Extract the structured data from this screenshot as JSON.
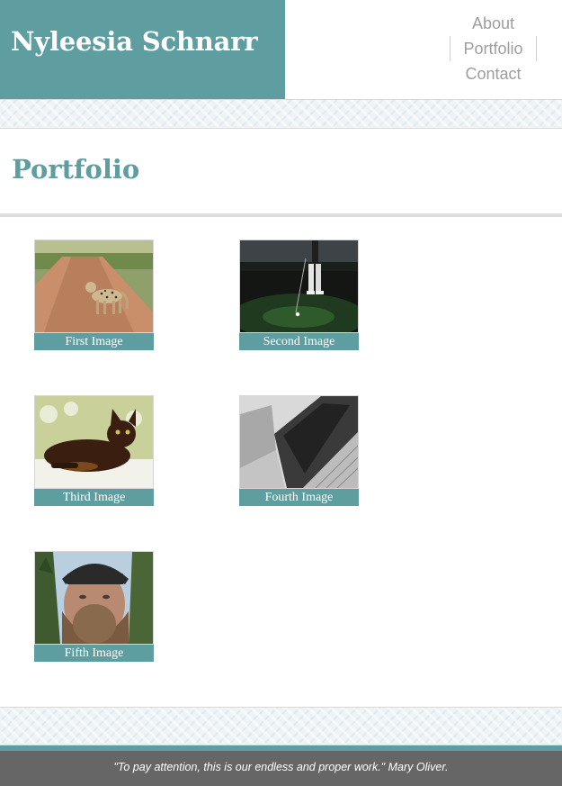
{
  "site": {
    "title": "Nyleesia Schnarr"
  },
  "nav": {
    "items": [
      {
        "label": "About"
      },
      {
        "label": "Portfolio"
      },
      {
        "label": "Contact"
      }
    ]
  },
  "page": {
    "title": "Portfolio"
  },
  "gallery": {
    "items": [
      {
        "caption": "First Image",
        "subject": "leopard on dirt road"
      },
      {
        "caption": "Second Image",
        "subject": "golfer putting at night"
      },
      {
        "caption": "Third Image",
        "subject": "brown cat on rug"
      },
      {
        "caption": "Fourth Image",
        "subject": "laptops on desk"
      },
      {
        "caption": "Fifth Image",
        "subject": "bearded man selfie"
      }
    ]
  },
  "footer": {
    "quote": "\"To pay attention, this is our endless and proper work.\" Mary Oliver."
  },
  "colors": {
    "accent": "#5f9ea0",
    "nav_text": "#9e9e9e",
    "footer_bg": "#666666"
  }
}
